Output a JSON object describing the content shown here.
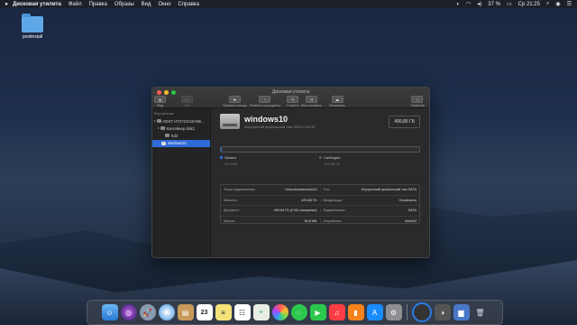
{
  "menubar": {
    "app_name": "Дисковая утилита",
    "items": [
      "Файл",
      "Правка",
      "Образы",
      "Вид",
      "Окно",
      "Справка"
    ],
    "battery": "37 %",
    "clock": "Ср 21:25"
  },
  "desktop": {
    "folder_label": "postinstall"
  },
  "window": {
    "title": "Дисковая утилита",
    "toolbar": {
      "view": "Вид",
      "volume": "Том",
      "first_aid": "Первая помощь",
      "partition": "Разбить на разделы",
      "erase": "Стереть",
      "restore": "Восстановить",
      "unmount": "Отключить",
      "info": "Свойства"
    },
    "sidebar": {
      "section": "Внутренние",
      "items": [
        {
          "label": "HDST HTS721010A9E..."
        },
        {
          "label": "Контейнер disk1"
        },
        {
          "label": "hdd"
        },
        {
          "label": "windows10"
        }
      ]
    },
    "disk": {
      "name": "windows10",
      "subtitle": "Внутренний физический том SATA • ExFAT",
      "size": "499,86 ГБ",
      "used_fraction": 0.0001
    },
    "legend": {
      "used_label": "Занято",
      "used_value": "35,8 МБ",
      "free_label": "Свободно",
      "free_value": "499,86 ГБ",
      "used_color": "#2f6bd7",
      "free_color": "#555555"
    },
    "info": {
      "rows": [
        {
          "k1": "Точка подключения:",
          "v1": "/Volumes/windows10",
          "k2": "Тип:",
          "v2": "Внутренний физический том SATA"
        },
        {
          "k1": "Емкость:",
          "v1": "499,86 ГБ",
          "k2": "Владельцы:",
          "v2": "Отключено"
        },
        {
          "k1": "Доступно:",
          "v1": "499,84 ГБ (0 КБ очищаемо)",
          "k2": "Подключение:",
          "v2": "SATA"
        },
        {
          "k1": "Занято:",
          "v1": "35,8 МБ",
          "k2": "Устройство:",
          "v2": "disk0s3"
        }
      ]
    }
  },
  "dock": {
    "icons": [
      "finder-icon",
      "siri-icon",
      "launchpad-icon",
      "safari-icon",
      "mail-icon",
      "notes-icon",
      "calendar-icon",
      "reminders-icon",
      "photos-icon",
      "messages-icon",
      "facetime-icon",
      "music-icon",
      "books-icon",
      "appstore-icon",
      "preferences-icon",
      "app-icon",
      "monitor-icon",
      "folder-icon",
      "trash-icon"
    ],
    "calendar_day": "23"
  }
}
